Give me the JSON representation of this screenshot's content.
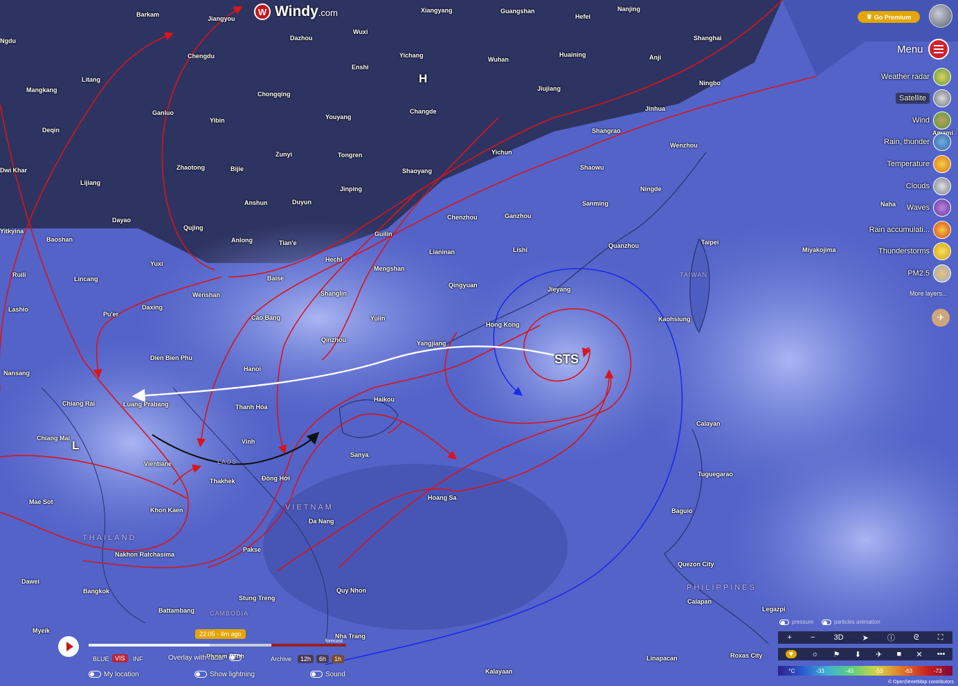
{
  "app": {
    "logo_text": "Windy",
    "logo_suffix": ".com",
    "go_premium": "Go Premium"
  },
  "menu": {
    "label": "Menu"
  },
  "layers": [
    {
      "label": "Weather radar",
      "icon": "radar-icon",
      "color": "#c8b44a"
    },
    {
      "label": "Satellite",
      "icon": "satellite-icon",
      "color": "#9ea6a8",
      "active": true
    },
    {
      "label": "Wind",
      "icon": "wind-icon",
      "color": "#6fae4a"
    },
    {
      "label": "Rain, thunder",
      "icon": "rain-icon",
      "color": "#4a86c4"
    },
    {
      "label": "Temperature",
      "icon": "temperature-icon",
      "color": "#f0a020"
    },
    {
      "label": "Clouds",
      "icon": "clouds-icon",
      "color": "#a8aab0"
    },
    {
      "label": "Waves",
      "icon": "waves-icon",
      "color": "#8a4ab0"
    },
    {
      "label": "Rain accumulati...",
      "icon": "rain-accum-icon",
      "color": "#e45a2a"
    },
    {
      "label": "Thunderstorms",
      "icon": "thunder-icon",
      "color": "#e8c020"
    },
    {
      "label": "PM2.5",
      "icon": "pm25-icon",
      "color": "#c0ccd8"
    }
  ],
  "more_layers": "More layers...",
  "storm": {
    "label": "STS",
    "high": "H",
    "low": "L"
  },
  "cities": [
    "Barkam",
    "Jiangyou",
    "Dazhou",
    "Wuxi",
    "Xiangyang",
    "Guangshan",
    "Hefei",
    "Nanjing",
    "Shanghai",
    "Chengdu",
    "Litang",
    "Mangkang",
    "Deqin",
    "Ganluo",
    "Yibin",
    "Chongqing",
    "Enshi",
    "Yichang",
    "Wuhan",
    "Huaining",
    "Anji",
    "Ningbo",
    "Jiujiang",
    "Changde",
    "Youyang",
    "Jinhua",
    "Shangrao",
    "Wenzhou",
    "Zhaotong",
    "Bijie",
    "Zunyi",
    "Tongren",
    "Shaoyang",
    "Yichun",
    "Shaowu",
    "Ningde",
    "Lijiang",
    "Anshun",
    "Duyun",
    "Jinping",
    "Sanming",
    "Dayao",
    "Qujing",
    "Anlong",
    "Tian'e",
    "Guilin",
    "Chenzhou",
    "Ganzhou",
    "Quanzhou",
    "Taipei",
    "Baoshan",
    "Yuxi",
    "Hechi",
    "Lianinan",
    "Lishi",
    "Miyakojima",
    "Ruili",
    "Lincang",
    "Baise",
    "Mengshan",
    "Qingyuan",
    "Jieyang",
    "Naha",
    "Lashio",
    "Pu'er",
    "Daxing",
    "Wenshan",
    "Shanglin",
    "Yulin",
    "Hong Kong",
    "Kaohsiung",
    "Cao Bang",
    "Qinzhou",
    "Yangjiang",
    "Dien Bien Phu",
    "Hanoi",
    "Nansang",
    "Chiang Rai",
    "Luang Prabang",
    "Thanh Hóa",
    "Haikou",
    "Chiang Mai",
    "Vinh",
    "Sanya",
    "Calayan",
    "Vientiane",
    "Thakhek",
    "Đồng Hới",
    "Tuguegarao",
    "Mae Sot",
    "Khon Kaen",
    "Hoang Sa",
    "Baguio",
    "Da Nang",
    "Nakhon Ratchasima",
    "Pakse",
    "Dawei",
    "Quezon City",
    "Bangkok",
    "Quy Nhon",
    "Stung Treng",
    "Battambang",
    "Calapan",
    "Legazpi",
    "Myeik",
    "Nha Trang",
    "Phnom Penh",
    "Roxas City",
    "Linapacan",
    "Kalayaan",
    "Yitkyina",
    "Ngdu",
    "Dwi Khar",
    "Amami"
  ],
  "countries": [
    "THAILAND",
    "VIETNAM",
    "CAMBODIA",
    "PHILIPPINES",
    "TAIWAN",
    "LAOS"
  ],
  "timeline": {
    "time_badge": "22:05 - 4m ago",
    "forecast_label": "forecast",
    "progress": 0.47,
    "forecast_from": 0.71,
    "bands": [
      "BLUE",
      "VIS",
      "INF"
    ],
    "active_band": "VIS",
    "overlay_radar": "Overlay with radar",
    "archive": "Archive",
    "archive_steps": [
      "12h",
      "6h",
      "1h"
    ],
    "my_location": "My location",
    "show_lightning": "Show lightning",
    "sound": "Sound"
  },
  "map_controls": {
    "pressure": "pressure",
    "particles": "particles animation",
    "zoom_in": "+",
    "zoom_out": "−",
    "three_d": "3D"
  },
  "legend": {
    "unit": "°C",
    "values": [
      "-33",
      "-43",
      "-53",
      "-63",
      "-73"
    ]
  },
  "attribution": "© OpenStreetMap contributors"
}
